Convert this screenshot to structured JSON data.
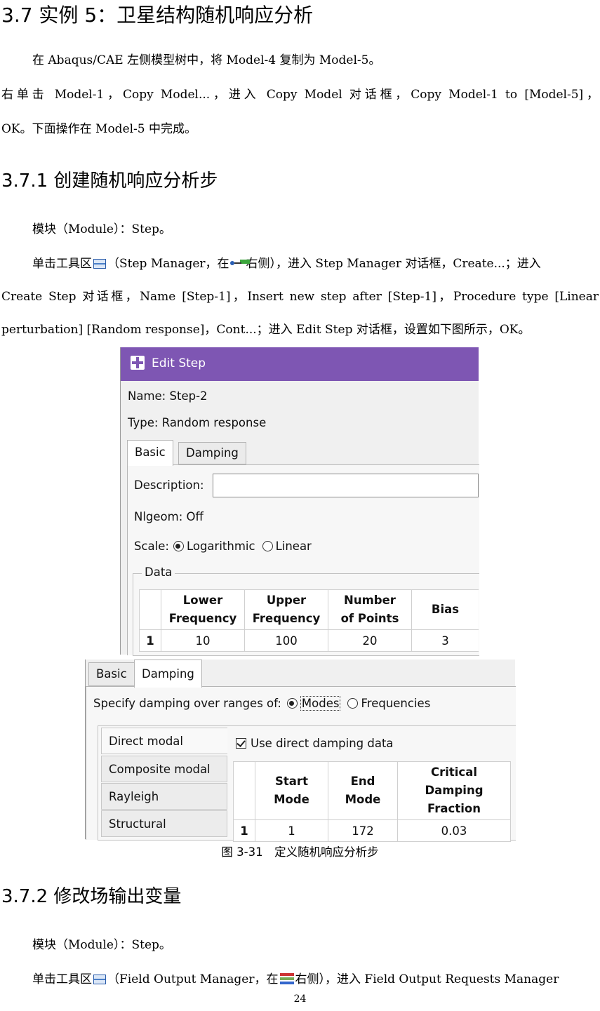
{
  "section": {
    "heading": "3.7 实例 5：卫星结构随机响应分析",
    "para1": "在 Abaqus/CAE 左侧模型树中，将 Model-4 复制为 Model-5。",
    "para2": "右单击 Model-1，Copy Model...，进入 Copy Model 对话框，Copy Model-1 to [Model-5]，",
    "para2_cont": "OK。下面操作在 Model-5 中完成。"
  },
  "sub1": {
    "heading": "3.7.1 创建随机响应分析步",
    "module": "模块（Module）：Step。",
    "p_a1": "单击工具区",
    "p_a2": "（Step Manager，在",
    "p_a3": "右侧），进入 Step Manager 对话框，Create...；进入",
    "p_b": "Create Step 对话框，Name [Step-1]，Insert new step after [Step-1]，Procedure type [Linear",
    "p_c": "perturbation] [Random response]，Cont...；进入 Edit Step 对话框，设置如下图所示，OK。"
  },
  "edit_step": {
    "title": "Edit Step",
    "name_label": "Name:",
    "name_value": "Step-2",
    "type_label": "Type:",
    "type_value": "Random response",
    "tabs": [
      "Basic",
      "Damping"
    ],
    "description_label": "Description:",
    "description_value": "",
    "nlgeom_label": "Nlgeom:",
    "nlgeom_value": "Off",
    "scale_label": "Scale:",
    "scale_options": [
      "Logarithmic",
      "Linear"
    ],
    "data_group": "Data",
    "columns": [
      [
        "Lower",
        "Frequency"
      ],
      [
        "Upper",
        "Frequency"
      ],
      [
        "Number",
        "of Points"
      ],
      [
        "Bias"
      ]
    ],
    "rows": [
      [
        "1",
        "10",
        "100",
        "20",
        "3"
      ]
    ]
  },
  "damping": {
    "tabs": [
      "Basic",
      "Damping"
    ],
    "specify_label": "Specify damping over ranges of:",
    "range_options": [
      "Modes",
      "Frequencies"
    ],
    "side_items": [
      "Direct modal",
      "Composite modal",
      "Rayleigh",
      "Structural"
    ],
    "use_direct_label": "Use direct damping data",
    "columns": [
      [
        "Start",
        "Mode"
      ],
      [
        "End",
        "Mode"
      ],
      [
        "Critical",
        "Damping Fraction"
      ]
    ],
    "rows": [
      [
        "1",
        "1",
        "172",
        "0.03"
      ]
    ]
  },
  "caption": "图 3-31　定义随机响应分析步",
  "sub2": {
    "heading": "3.7.2 修改场输出变量",
    "module": "模块（Module）：Step。",
    "p_a1": "单击工具区",
    "p_a2": "（Field Output Manager，在",
    "p_a3": "右侧），进入 Field Output Requests Manager"
  },
  "page_number": "24"
}
